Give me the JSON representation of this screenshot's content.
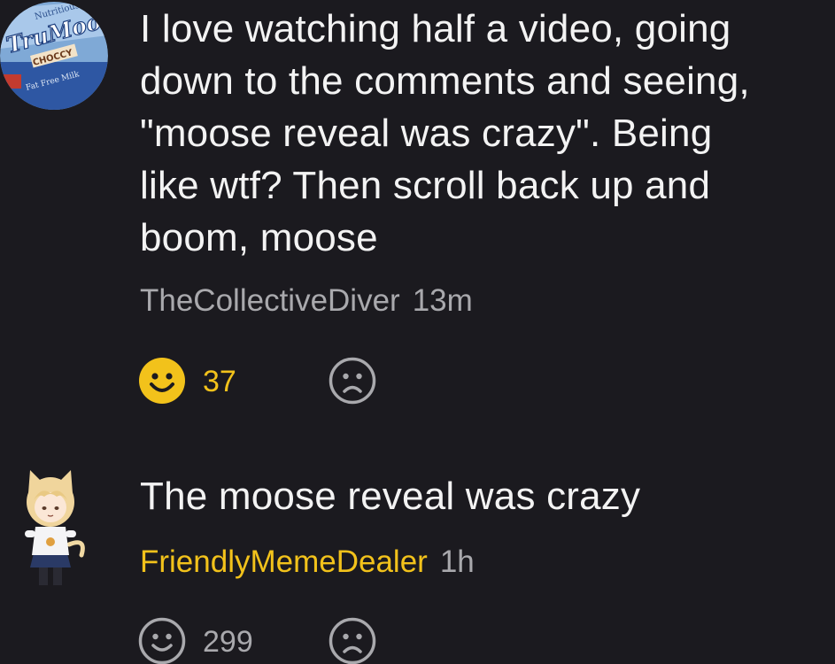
{
  "comments": [
    {
      "text": "I love watching half a video, going\ndown to the comments and seeing,\n\"moose reveal was crazy\". Being\nlike wtf? Then scroll back up and\nboom, moose",
      "username": "TheCollectiveDiver",
      "time": "13m",
      "likes": "37",
      "liked": true,
      "avatar_brand": "TruMoo",
      "avatar_flavor": "CHOCCY"
    },
    {
      "text": "The moose reveal was crazy",
      "username": "FriendlyMemeDealer",
      "time": "1h",
      "likes": "299",
      "liked": false
    }
  ],
  "colors": {
    "background": "#1b1a1f",
    "accent": "#f2c21b",
    "muted": "#a9a9ad"
  },
  "icons": {
    "like": "smile-face-icon",
    "dislike": "frown-face-icon"
  }
}
